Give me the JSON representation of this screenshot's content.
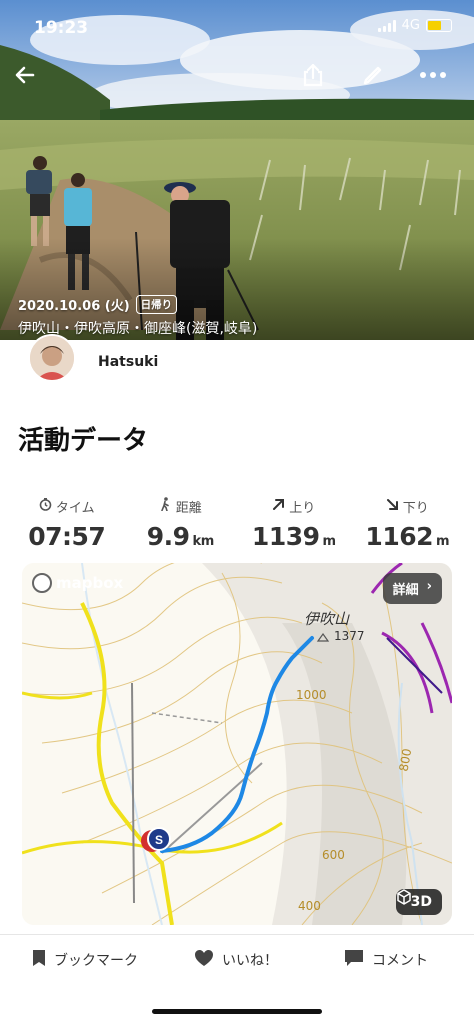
{
  "status_bar": {
    "time": "19:23",
    "network": "4G"
  },
  "hero": {
    "date": "2020.10.06 (火)",
    "trip_type": "日帰り",
    "places": "伊吹山・伊吹高原・御座峰(滋賀,岐阜)"
  },
  "icons": {
    "back": "back-arrow-icon",
    "share": "share-icon",
    "edit": "pencil-icon",
    "more": "more-dots-icon"
  },
  "author": {
    "name": "Hatsuki"
  },
  "section_title": "活動データ",
  "stats": [
    {
      "label": "タイム",
      "value": "07:57",
      "unit": "",
      "icon": "clock-icon"
    },
    {
      "label": "距離",
      "value": "9.9",
      "unit": "km",
      "icon": "hiker-icon"
    },
    {
      "label": "上り",
      "value": "1139",
      "unit": "m",
      "icon": "arrow-up-right-icon"
    },
    {
      "label": "下り",
      "value": "1162",
      "unit": "m",
      "icon": "arrow-down-right-icon"
    }
  ],
  "map": {
    "attribution": "mapbox",
    "detail_label": "詳細",
    "detail_chevron": "›",
    "btn_3d": "3D",
    "start_marker": "S",
    "peak_name": "伊吹山",
    "peak_elevation": "1377",
    "contour_labels": [
      "1000",
      "800",
      "600",
      "400"
    ],
    "route_color": "#1e88e5"
  },
  "bottom_bar": {
    "bookmark": "ブックマーク",
    "like": "いいね！",
    "comment": "コメント"
  }
}
